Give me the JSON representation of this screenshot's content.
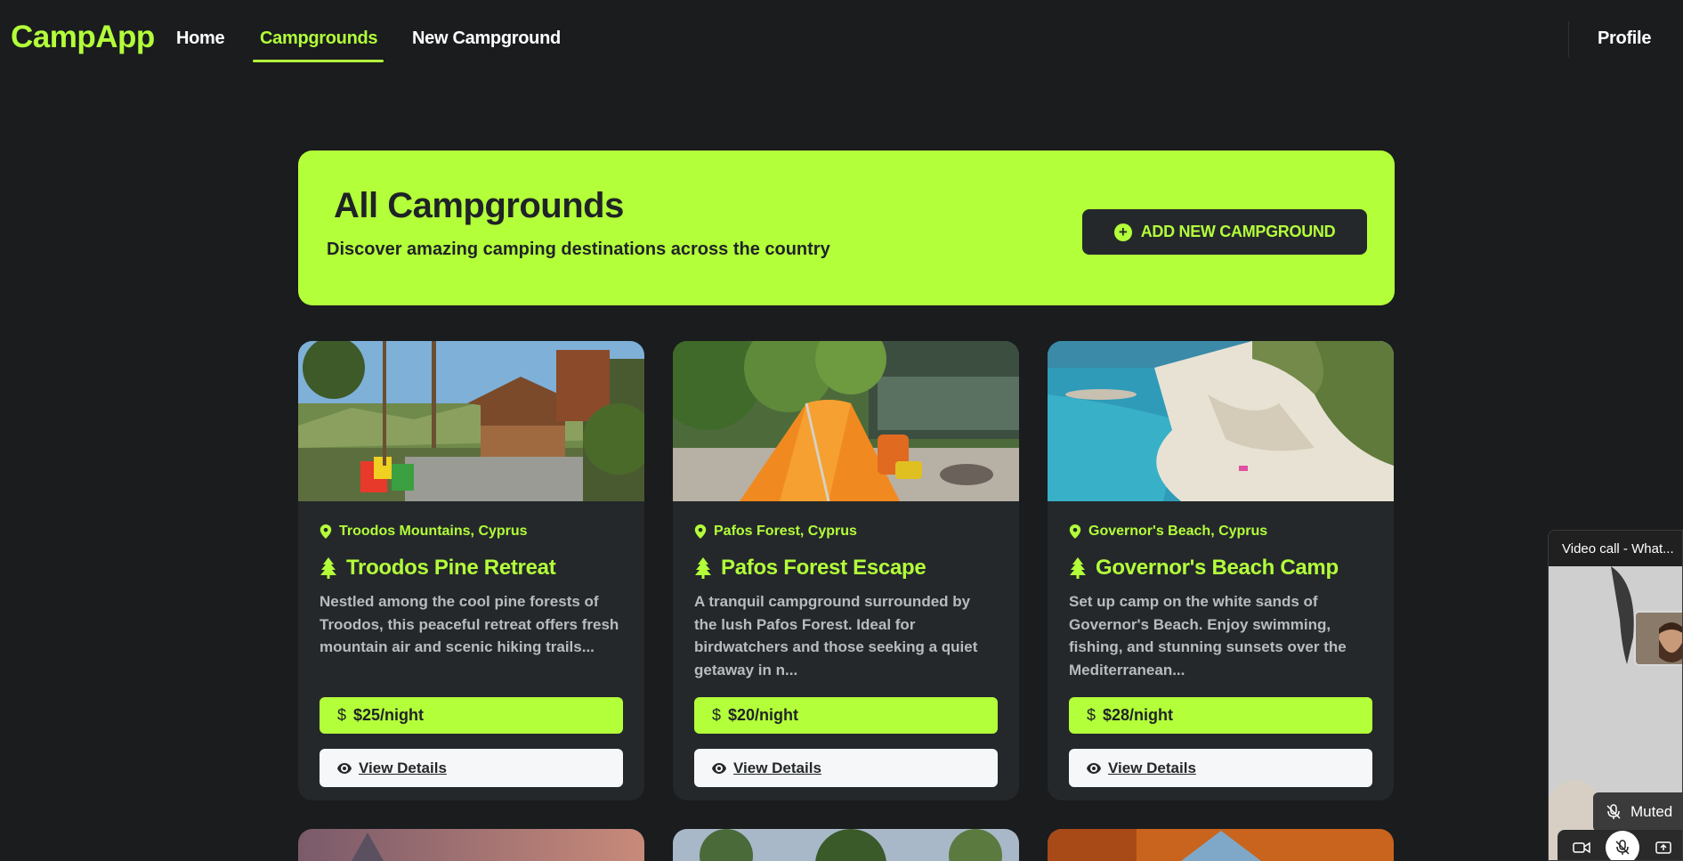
{
  "navbar": {
    "brand": "CampApp",
    "links": [
      {
        "label": "Home",
        "active": false
      },
      {
        "label": "Campgrounds",
        "active": true
      },
      {
        "label": "New Campground",
        "active": false
      }
    ],
    "profile_label": "Profile"
  },
  "hero": {
    "title": "All Campgrounds",
    "subtitle": "Discover amazing camping destinations across the country",
    "add_button_label": "ADD NEW CAMPGROUND"
  },
  "campgrounds": [
    {
      "location": "Troodos Mountains, Cyprus",
      "title": "Troodos Pine Retreat",
      "description": "Nestled among the cool pine forests of Troodos, this peaceful retreat offers fresh mountain air and scenic hiking trails...",
      "price": "$25/night",
      "view_label": "View Details"
    },
    {
      "location": "Pafos Forest, Cyprus",
      "title": "Pafos Forest Escape",
      "description": "A tranquil campground surrounded by the lush Pafos Forest. Ideal for birdwatchers and those seeking a quiet getaway in n...",
      "price": "$20/night",
      "view_label": "View Details"
    },
    {
      "location": "Governor's Beach, Cyprus",
      "title": "Governor's Beach Camp",
      "description": "Set up camp on the white sands of Governor's Beach. Enjoy swimming, fishing, and stunning sunsets over the Mediterranean...",
      "price": "$28/night",
      "view_label": "View Details"
    }
  ],
  "video_call": {
    "title": "Video call - What...",
    "muted_label": "Muted"
  },
  "colors": {
    "accent": "#b3ff3a",
    "background": "#1a1c1e",
    "card": "#24282b"
  },
  "icons": [
    "plus-circle-icon",
    "map-pin-icon",
    "tree-icon",
    "dollar-icon",
    "eye-icon",
    "mic-off-icon",
    "camera-icon"
  ]
}
